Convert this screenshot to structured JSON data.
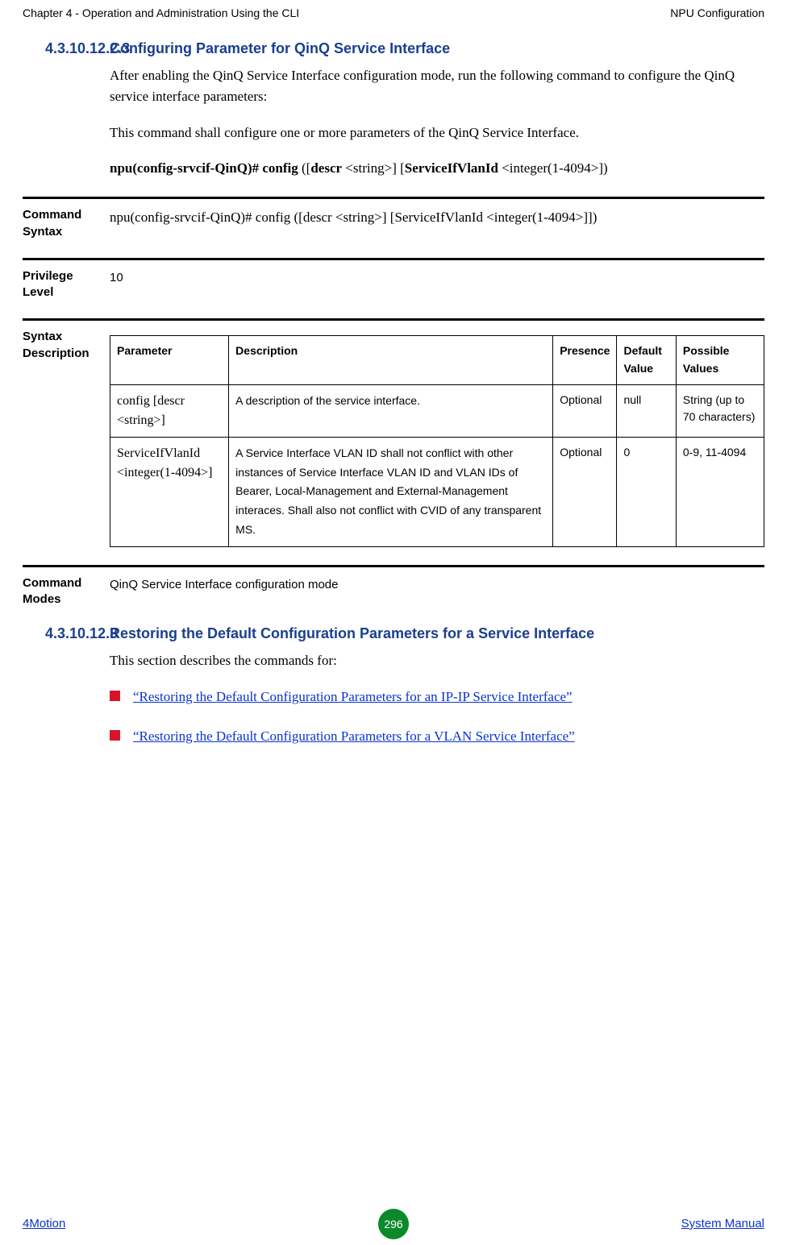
{
  "header": {
    "left": "Chapter 4 - Operation and Administration Using the CLI",
    "right": "NPU Configuration"
  },
  "sections": [
    {
      "number": "4.3.10.12.2.3",
      "title": "Configuring Parameter for QinQ Service Interface",
      "paras": [
        "After enabling the QinQ Service Interface configuration mode, run the following command to configure the QinQ service interface parameters:",
        "This command shall configure one or more parameters of the QinQ Service Interface."
      ],
      "command": {
        "parts": [
          "npu(config-srvcif-QinQ)# config",
          " ([",
          "descr",
          " <string>] [",
          "ServiceIfVlanId",
          " <integer(1-4094>])"
        ]
      }
    },
    {
      "number": "4.3.10.12.3",
      "title": "Restoring the Default Configuration Parameters for a Service Interface",
      "paras": [
        "This section describes the commands for:"
      ],
      "links": [
        "“Restoring the Default Configuration Parameters for an IP-IP Service Interface”",
        "“Restoring the Default Configuration Parameters for a VLAN Service Interface”"
      ]
    }
  ],
  "blocks": {
    "syntax": {
      "label": "Command Syntax",
      "value": {
        "parts": [
          "npu(config-srvcif-QinQ)# config",
          " ([",
          "descr",
          " <string>] [",
          "ServiceIfVlanId",
          " <integer(1-4094>]])"
        ]
      }
    },
    "privilege": {
      "label": "Privilege Level",
      "value": "10"
    },
    "syntaxDesc": {
      "label": "Syntax Description",
      "table": {
        "headers": [
          "Parameter",
          "Description",
          "Presence",
          "Default Value",
          "Possible Values"
        ],
        "rows": [
          [
            "config [descr <string>]",
            "A description of the service interface.",
            "Optional",
            "null",
            "String (up to 70 characters)"
          ],
          [
            "ServiceIfVlanId <integer(1-4094>]",
            "A Service Interface VLAN ID shall not conflict with other instances of Service Interface VLAN ID and VLAN IDs of Bearer, Local-Management and External-Management interaces.  Shall also not conflict with CVID of any transparent MS.",
            "Optional",
            "0",
            "0-9, 11-4094"
          ]
        ]
      }
    },
    "modes": {
      "label": "Command Modes",
      "value": "QinQ Service Interface configuration mode"
    }
  },
  "footer": {
    "left": "4Motion",
    "page": "296",
    "right": "System Manual"
  }
}
